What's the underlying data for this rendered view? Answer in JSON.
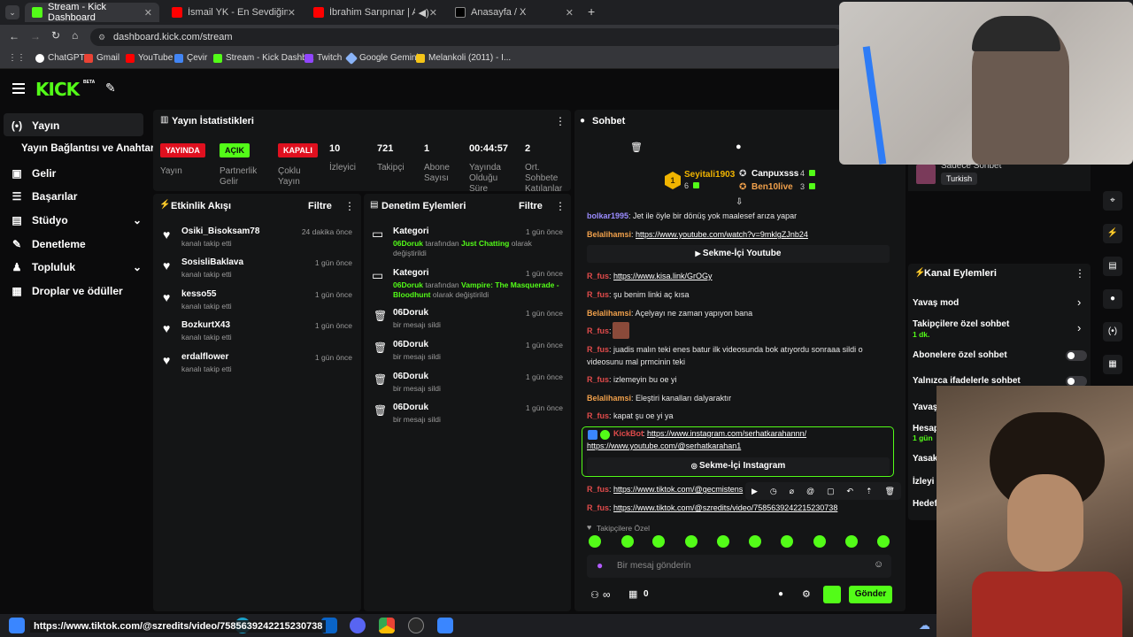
{
  "browser": {
    "tabs": [
      {
        "label": "Stream - Kick Dashboard",
        "color": "#53fc18"
      },
      {
        "label": "İsmail YK - En Sevdiğim Şarkısı",
        "color": "#ff0000"
      },
      {
        "label": "İbrahim Sarıpınar | Aha Şer",
        "color": "#ff0000"
      },
      {
        "label": "Anasayfa / X",
        "color": "#000000"
      }
    ],
    "close_glyph": "✕",
    "new_tab_glyph": "+",
    "url": "dashboard.kick.com/stream",
    "bookmarks": [
      {
        "label": "ChatGPT",
        "color": "#ffffff"
      },
      {
        "label": "Gmail",
        "color": "#ea4335"
      },
      {
        "label": "YouTube",
        "color": "#ff0000"
      },
      {
        "label": "Çevir",
        "color": "#4285f4"
      },
      {
        "label": "Stream - Kick Dashb...",
        "color": "#53fc18"
      },
      {
        "label": "Twitch",
        "color": "#9146ff"
      },
      {
        "label": "Google Gemini",
        "color": "#8ab4f8"
      },
      {
        "label": "Melankoli (2011) - I...",
        "color": "#f5c518"
      }
    ]
  },
  "kick": {
    "logo": "KICK",
    "beta": "BETA"
  },
  "sidebar": {
    "items": [
      {
        "label": "Yayın",
        "icon": "broadcast-icon"
      },
      {
        "label": "Yayın Bağlantısı ve Anahtarı"
      },
      {
        "label": "Gelir",
        "icon": "wallet-icon"
      },
      {
        "label": "Başarılar",
        "icon": "list-icon"
      },
      {
        "label": "Stüdyo",
        "icon": "studio-icon"
      },
      {
        "label": "Denetleme",
        "icon": "wrench-icon"
      },
      {
        "label": "Topluluk",
        "icon": "people-icon"
      },
      {
        "label": "Droplar ve ödüller",
        "icon": "gift-icon"
      }
    ]
  },
  "stats": {
    "title": "Yayın İstatistikleri",
    "badges": [
      {
        "text": "YAYINDA",
        "bg": "#e0101f",
        "fg": "#ffffff",
        "label": "Yayın"
      },
      {
        "text": "AÇIK",
        "bg": "#53fc18",
        "fg": "#0b0b0c",
        "label": "Partnerlik Gelir"
      },
      {
        "text": "KAPALI",
        "bg": "#e0101f",
        "fg": "#ffffff",
        "label": "Çoklu Yayın"
      }
    ],
    "metrics": [
      {
        "value": "10",
        "label": "İzleyici"
      },
      {
        "value": "721",
        "label": "Takipçi"
      },
      {
        "value": "1",
        "label": "Abone Sayısı"
      },
      {
        "value": "00:44:57",
        "label": "Yayında Olduğu Süre"
      },
      {
        "value": "2",
        "label": "Ort. Sohbete Katılanlar"
      }
    ]
  },
  "activity": {
    "title": "Etkinlik Akışı",
    "filter": "Filtre",
    "items": [
      {
        "name": "Osiki_Bisoksam78",
        "sub": "kanalı takip etti",
        "time": "24 dakika önce"
      },
      {
        "name": "SosisliBaklava",
        "sub": "kanalı takip etti",
        "time": "1 gün önce"
      },
      {
        "name": "kesso55",
        "sub": "kanalı takip etti",
        "time": "1 gün önce"
      },
      {
        "name": "BozkurtX43",
        "sub": "kanalı takip etti",
        "time": "1 gün önce"
      },
      {
        "name": "erdalflower",
        "sub": "kanalı takip etti",
        "time": "1 gün önce"
      }
    ]
  },
  "moderation": {
    "title": "Denetim Eylemleri",
    "filter": "Filtre",
    "categories": [
      {
        "title": "Kategori",
        "time": "1 gün önce",
        "user": "06Doruk",
        "mid": " tarafından ",
        "cat": "Just Chatting",
        "tail": " olarak",
        "line2": "değiştirildi"
      },
      {
        "title": "Kategori",
        "time": "1 gün önce",
        "user": "06Doruk",
        "mid": " tarafından ",
        "cat": "Vampire: The Masquerade -",
        "tail": "",
        "line2": "Bloodhunt",
        "line2tail": " olarak değiştirildi"
      }
    ],
    "deletes": [
      {
        "name": "06Doruk",
        "sub": "bir mesajı sildi",
        "time": "1 gün önce"
      },
      {
        "name": "06Doruk",
        "sub": "bir mesajı sildi",
        "time": "1 gün önce"
      },
      {
        "name": "06Doruk",
        "sub": "bir mesajı sildi",
        "time": "1 gün önce"
      },
      {
        "name": "06Doruk",
        "sub": "bir mesajı sildi",
        "time": "1 gün önce"
      }
    ]
  },
  "chat": {
    "title": "Sohbet",
    "leader": {
      "name": "Seyitali1903",
      "count": "6",
      "rank": "1"
    },
    "others": [
      {
        "name": "Canpuxsss",
        "count": "4"
      },
      {
        "name": "Ben10live",
        "count": "3"
      }
    ],
    "lines": [
      {
        "user": "bolkar1995",
        "cls": "u-purple",
        "text": ": Jet ile öyle bir dönüş yok maalesef arıza yapar"
      },
      {
        "user": "Belalihamsi",
        "cls": "u-orange",
        "text": ": ",
        "link": "https://www.youtube.com/watch?v=9mklgZJnb24"
      },
      {
        "user": "R_fus",
        "cls": "u-red",
        "text": ": ",
        "link": "https://www.kisa.link/GrOGy"
      },
      {
        "user": "R_fus",
        "cls": "u-red",
        "text": ": şu benim linki aç kısa"
      },
      {
        "user": "Belalihamsi",
        "cls": "u-orange",
        "text": ": Açelyayı ne zaman yapıyon bana"
      },
      {
        "user": "R_fus",
        "cls": "u-red",
        "text": ":"
      },
      {
        "user": "R_fus",
        "cls": "u-red",
        "text": ": juadis malın teki enes batur ilk videosunda bok atıyordu sonraaa sildi o"
      },
      {
        "text": "videosunu mal prmcinin teki"
      },
      {
        "user": "R_fus",
        "cls": "u-red",
        "text": ": izlemeyin bu oe yi"
      },
      {
        "user": "Belalihamsi",
        "cls": "u-orange",
        "text": ": Eleştiri kanalları dalyaraktır"
      },
      {
        "user": "R_fus",
        "cls": "u-red",
        "text": ": kapat şu oe yi ya"
      },
      {
        "user": "R_fus",
        "cls": "u-red",
        "text": ": ",
        "link": "https://www.tiktok.com/@gecmistens"
      },
      {
        "user": "R_fus",
        "cls": "u-red",
        "text": ": ",
        "link": "https://www.tiktok.com/@szredits/video/7585639242215230738"
      }
    ],
    "yt_embed": "Sekme-İçi Youtube",
    "kickbot": {
      "user": "KickBot",
      "link1": "https://www.instagram.com/serhatkarahannn/",
      "link2": "https://www.youtube.com/@serhatkarahan1",
      "embed": "Sekme-İçi Instagram"
    },
    "followers_only": "Takipçilere Özel",
    "input_placeholder": "Bir mesaj gönderin",
    "infinite": "∞",
    "count": "0",
    "send": "Gönder"
  },
  "channel_actions": {
    "title": "Kanal Eylemleri",
    "user_label": "Sadece Sohbet",
    "lang": "Turkish",
    "items": [
      {
        "label": "Yavaş mod"
      },
      {
        "label": "Takipçilere özel sohbet",
        "sub": "1 dk."
      },
      {
        "label": "Abonelere özel sohbet"
      },
      {
        "label": "Yalnızca ifadelerle sohbet"
      },
      {
        "label": "Yavaş"
      },
      {
        "label": "Hesap",
        "sub": "1 gün"
      },
      {
        "label": "Yasak"
      },
      {
        "label": "İzleyi"
      },
      {
        "label": "Hedef"
      }
    ]
  },
  "tooltip": {
    "text": "https://www.tiktok.com/@szredits/video/7585639242215230738"
  }
}
